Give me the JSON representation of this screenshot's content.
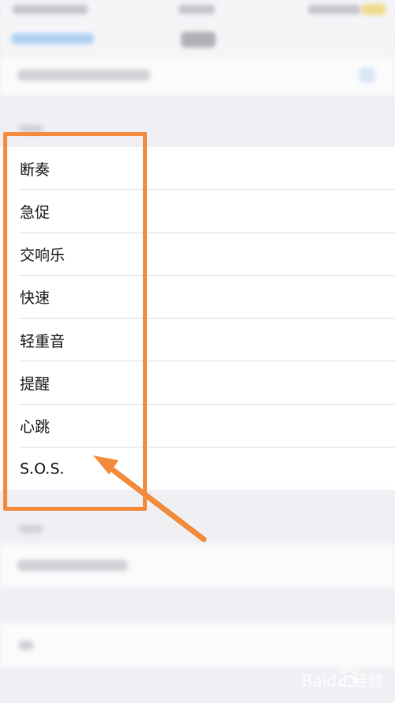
{
  "ringtone_list": {
    "items": [
      {
        "label": "断奏"
      },
      {
        "label": "急促"
      },
      {
        "label": "交响乐"
      },
      {
        "label": "快速"
      },
      {
        "label": "轻重音"
      },
      {
        "label": "提醒"
      },
      {
        "label": "心跳"
      },
      {
        "label": "S.O.S."
      }
    ]
  },
  "annotation": {
    "color": "#f48a3c",
    "icon": "arrow-up-left-icon"
  },
  "watermark": {
    "text": "Baidu 经验"
  }
}
